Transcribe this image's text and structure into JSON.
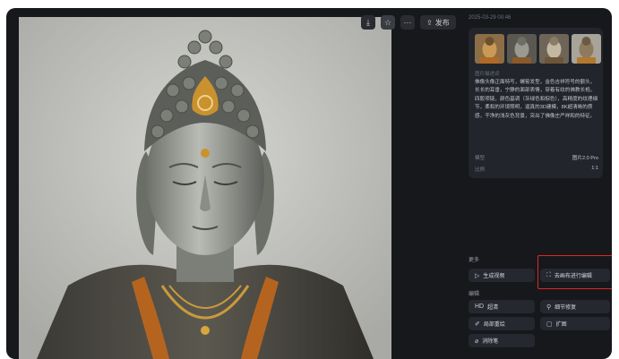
{
  "toolbar": {
    "download_icon": "download-icon",
    "favorite_icon": "star-icon",
    "more_label": "···",
    "publish_label": "发布"
  },
  "image_alt": "Buddha statue portrait",
  "sidebar": {
    "date": "2025-03-29 00:46",
    "prompt_label": "图片描述词",
    "prompt_text": "佛像头像正面特写，螺髻发型，金色吉祥符号的额头，长长的耳垂，宁静的面部表情，穿着有纹的佛教长袍，四股项链，颜色基调（灰绿色和棕色），高精度的纹理细节，柔和的环境照明，逼真的3D建模，8K超清晰的质感，干净的浅灰色背景，突出了佛像庄严祥和的特征。",
    "model_label": "模型",
    "model_value": "图片2.0 Pro",
    "ratio_label": "比例",
    "ratio_value": "1:1",
    "more_title": "更多",
    "edit_title": "编辑",
    "buttons": {
      "generate_video": "生成视频",
      "go_edit": "去画布进行编辑",
      "hd": "超清",
      "detail_fix": "细节修复",
      "local_redraw": "局部重绘",
      "expand": "扩图",
      "eraser": "消除笔"
    }
  },
  "colors": {
    "background": "#16181c",
    "panel": "#22252b",
    "highlight": "#e0262b"
  }
}
